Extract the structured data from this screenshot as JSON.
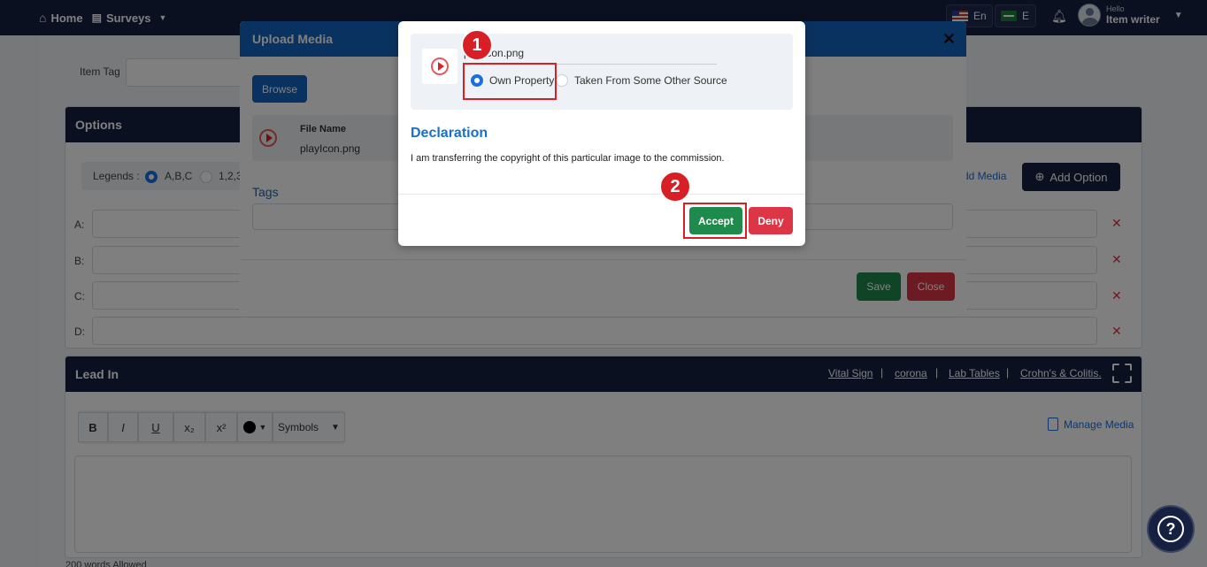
{
  "topnav": {
    "home_label": "Home",
    "surveys_label": "Surveys",
    "lang_en": "En",
    "lang_ar": "E",
    "greeting": "Hello",
    "user_name": "Item writer"
  },
  "form": {
    "item_tag_label": "Item Tag",
    "options_title": "Options",
    "legends_label": "Legends :",
    "legend_abc": "A,B,C",
    "legend_123": "1,2,3",
    "add_media_label": "Add Media",
    "add_option_label": "Add Option",
    "option_rows": [
      {
        "letter": "A:"
      },
      {
        "letter": "B:"
      },
      {
        "letter": "C:"
      },
      {
        "letter": "D:"
      }
    ],
    "remove_icon_glyph": "✕",
    "lead_in_title": "Lead In",
    "lead_in_links": [
      "Vital Sign",
      "corona",
      "Lab Tables",
      "Crohn's & Colitis."
    ],
    "link_separator": "|",
    "toolbar": {
      "bold": "B",
      "italic": "I",
      "underline": "U",
      "subscript": "x₂",
      "superscript": "x²",
      "symbols": "Symbols"
    },
    "manage_media_label": "Manage Media",
    "words_allowed": "200 words Allowed"
  },
  "upload_modal": {
    "title": "Upload Media",
    "close_glyph": "✕",
    "browse_label": "Browse",
    "file_name_label": "File Name",
    "file_name_value": "playIcon.png",
    "tags_label": "Tags",
    "save_label": "Save",
    "close_label": "Close"
  },
  "declaration_dialog": {
    "file_name": "playIcon.png",
    "own_property_label": "Own Property",
    "other_source_label": "Taken From Some Other Source",
    "declaration_title": "Declaration",
    "declaration_text": "I am transferring the copyright of this particular image to the commission.",
    "accept_label": "Accept",
    "deny_label": "Deny"
  },
  "annotations": {
    "step1": "1",
    "step2": "2"
  },
  "help_glyph": "?",
  "colors": {
    "nav": "#162142",
    "modal_header": "#1565c0",
    "accept": "#1e8a4c",
    "deny": "#dc3545",
    "annotation": "#d91f26"
  }
}
